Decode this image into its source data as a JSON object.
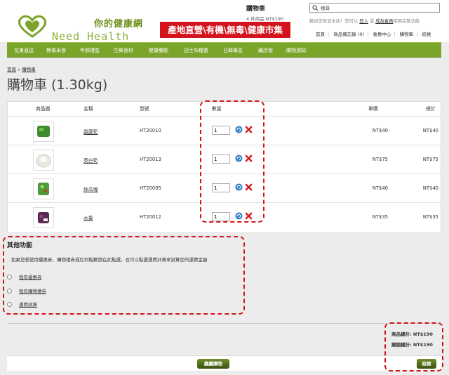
{
  "header": {
    "logo_cn": "你的健康網",
    "logo_en": "Need Health",
    "banner": "產地直營\\有機\\無毒\\健康市集",
    "cart_title": "購物車",
    "cart_count": "4 件商品 NT$190",
    "search_value": "搜尋",
    "welcome_prefix": "歡迎您來到本店！您可以",
    "login": "登入",
    "welcome_or": "或",
    "register": "成為會員",
    "welcome_suffix": "使用完整功能",
    "links": [
      "首頁",
      "商品備忘錄 (0)",
      "會員中心",
      "購物車",
      "結帳"
    ]
  },
  "nav": {
    "items": [
      "花東直送",
      "無毒米食",
      "年節禮盒",
      "生鮮食材",
      "健康餐點",
      "田士布種苗",
      "日韓專區",
      "藏店街",
      "購物須知"
    ]
  },
  "breadcrumb": {
    "home": "首頁",
    "sep": "»",
    "current": "購物車"
  },
  "page_title": "購物車 (1.30kg)",
  "table": {
    "headers": {
      "image": "商品圖",
      "name": "名稱",
      "model": "型號",
      "qty": "數量",
      "unit_price": "單價",
      "total": "總計"
    },
    "rows": [
      {
        "name": "霜蘆筍",
        "model": "HT20010",
        "qty": "1",
        "unit_price": "NT$40",
        "total": "NT$40",
        "color": "#3f8a2e"
      },
      {
        "name": "茭白筍",
        "model": "HT20013",
        "qty": "1",
        "unit_price": "NT$75",
        "total": "NT$75",
        "color": "#e8ede0"
      },
      {
        "name": "絲瓜塊",
        "model": "HT20005",
        "qty": "1",
        "unit_price": "NT$40",
        "total": "NT$40",
        "color": "#4f9a3a"
      },
      {
        "name": "水果",
        "model": "HT20012",
        "qty": "1",
        "unit_price": "NT$35",
        "total": "NT$35",
        "color": "#5a2a52"
      }
    ]
  },
  "other": {
    "title": "其他功能",
    "desc": "如果您想使用優惠券、購物禮券或紅利點數請在此點選，也可以點選運費計算來試算您的運費金額",
    "options": [
      "我有優惠券",
      "我有購物禮券",
      "運費試算"
    ]
  },
  "totals": {
    "subtotal_label": "商品總計:",
    "subtotal_value": "NT$190",
    "grand_label": "總額總計:",
    "grand_value": "NT$190"
  },
  "buttons": {
    "continue": "繼續購物",
    "checkout": "結帳"
  },
  "colors": {
    "nav": "#7ba42b",
    "accent": "#d4141c",
    "button": "#4a5a18"
  }
}
